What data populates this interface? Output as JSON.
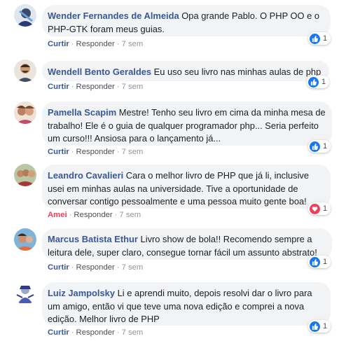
{
  "comments": [
    {
      "author": "Wender Fernandes de Almeida",
      "text": " Opa grande Pablo. O PHP OO e o PHP-GTK foram meus guias.",
      "action": "Curtir",
      "reply": "Responder",
      "time": "7 sem",
      "reaction": "like-icon",
      "count": "1"
    },
    {
      "author": "Wendell Bento Geraldes",
      "text": " Eu uso seu livro nas minhas aulas de php",
      "action": "Curtir",
      "reply": "Responder",
      "time": "7 sem",
      "reaction": "like-icon",
      "count": "1"
    },
    {
      "author": "Pamella Scapim",
      "text": " Mestre! Tenho seu livro em cima da minha mesa de trabalho! Ele é o guia de qualquer programador php... Seria perfeito um curso!!! Ansiosa para o lançamento já...",
      "action": "Curtir",
      "reply": "Responder",
      "time": "7 sem",
      "reaction": "like-icon",
      "count": "1"
    },
    {
      "author": "Leandro Cavalieri",
      "text": " Cara o melhor livro de PHP que já li, inclusive usei em minhas aulas na universidade. Tive a oportunidade de conversar contigo pessoalmente e uma pessoa muito gente boa!",
      "action": "Amei",
      "reply": "Responder",
      "time": "7 sem",
      "reaction": "heart-icon",
      "count": "1"
    },
    {
      "author": "Marcus Batista Ethur",
      "text": " Livro show de bola!! Recomendo sempre a leitura dele, super claro, consegue tornar fácil um assunto abstrato!",
      "action": "Curtir",
      "reply": "Responder",
      "time": "7 sem",
      "reaction": "like-icon",
      "count": "1"
    },
    {
      "author": "Luiz Jampolsky",
      "text": " Li e aprendi muito, depois resolvi dar o livro para um amigo, então vi que teve uma nova edição e comprei a nova edição. Melhor livro de PHP",
      "action": "Curtir",
      "reply": "Responder",
      "time": "7 sem",
      "reaction": "like-icon",
      "count": "1"
    }
  ],
  "colors": {
    "author": "#385898",
    "bubble": "#f2f3f5",
    "like": "#1877f2",
    "love": "#f33e58",
    "meta": "#90949c"
  }
}
